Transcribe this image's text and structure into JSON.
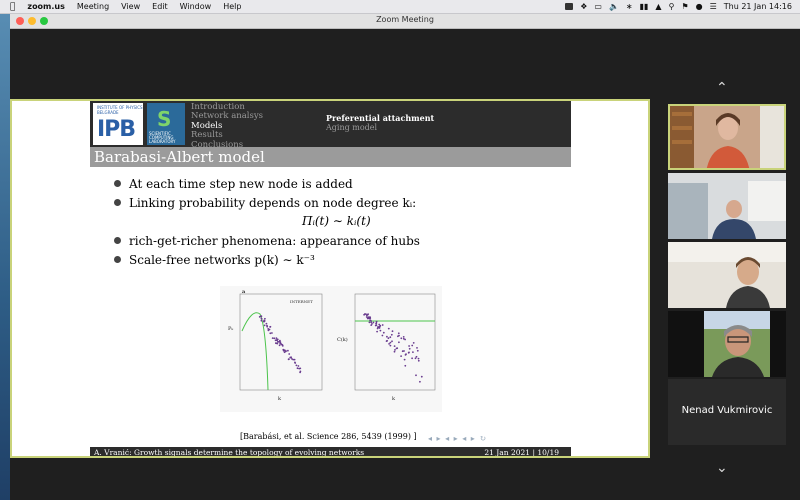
{
  "menubar": {
    "app_name": "zoom.us",
    "items": [
      "Meeting",
      "View",
      "Edit",
      "Window",
      "Help"
    ],
    "clock": "Thu 21 Jan  14:16"
  },
  "window": {
    "title": "Zoom Meeting"
  },
  "slide": {
    "nav_left": [
      "Introduction",
      "Network analsys",
      "Models",
      "Results",
      "Conclusions"
    ],
    "nav_left_active_index": 2,
    "nav_right": [
      "Preferential attachment",
      "Aging model"
    ],
    "nav_right_active_index": 0,
    "title": "Barabasi-Albert model",
    "bullets": [
      "At each time step new node is added",
      "Linking probability depends on node degree kᵢ:",
      "rich-get-richer phenomena: appearance of hubs",
      "Scale-free networks p(k) ∼ k⁻³"
    ],
    "formula": "Πᵢ(t) ∼ kᵢ(t)",
    "figure": {
      "panel_a_label": "a",
      "panel_a_tag": "INTERNET",
      "panel_a_ylabel": "Pₖ",
      "panel_a_xlabel": "k",
      "panel_b_ylabel": "C(k)",
      "panel_b_xlabel": "k"
    },
    "citation": "[Barabási, et al. Science 286, 5439 (1999) ]",
    "footer_left": "A. Vranić: Growth signals determine the topology of evolving networks",
    "footer_right": "21 Jan 2021   |   10/19",
    "logo_ipb_caption": "INSTITUTE OF PHYSICS BELGRADE",
    "logo_ipb_text": "IPB",
    "logo_scl_caption": "SCIENTIFIC COMPUTING LABORATORY"
  },
  "gallery": {
    "participant_name": "Nenad Vukmirovic"
  },
  "colors": {
    "active_speaker_border": "#c9d37a",
    "slide_header": "#2c2c2c",
    "slide_title_bar": "#9b9b9b",
    "plot_points": "#6a3d8f",
    "plot_lines": "#4cc44c"
  }
}
